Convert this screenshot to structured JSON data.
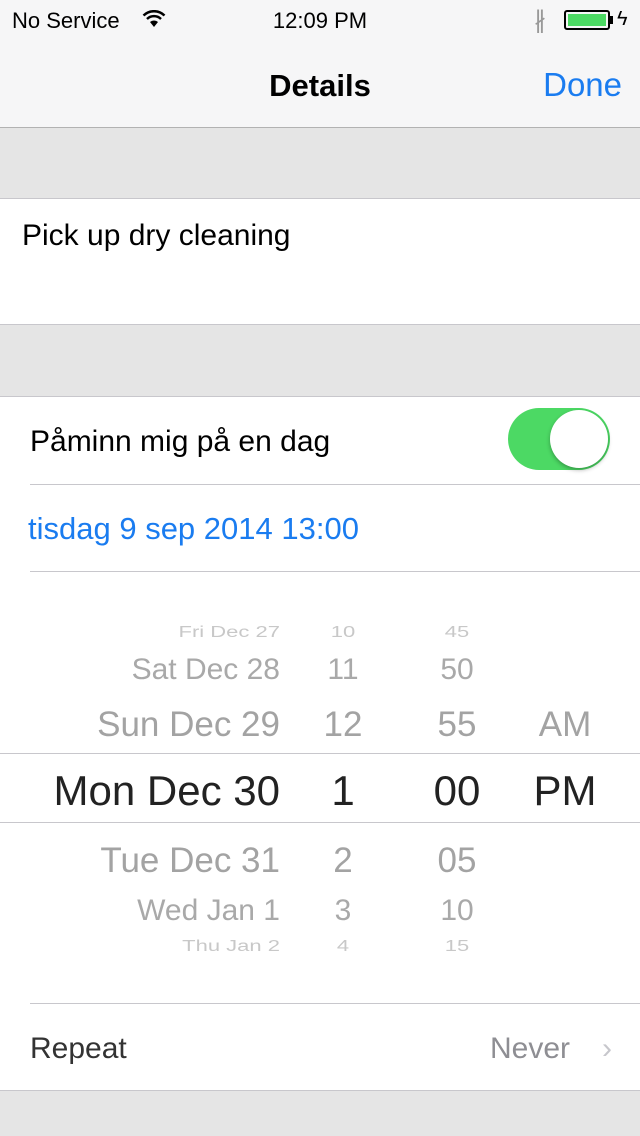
{
  "status": {
    "carrier": "No Service",
    "time": "12:09 PM",
    "battery_color": "#4cd964"
  },
  "nav": {
    "title": "Details",
    "done_label": "Done",
    "accent": "#1a7cf0"
  },
  "task": {
    "title": "Pick up dry cleaning"
  },
  "reminder": {
    "label": "Påminn mig på en dag",
    "toggle_on": true,
    "toggle_color": "#4cd964",
    "date_text": "tisdag 9 sep 2014 13:00"
  },
  "picker": {
    "rows": [
      {
        "date": "Fri Dec 27",
        "hour": "10",
        "minute": "45",
        "ampm": ""
      },
      {
        "date": "Sat Dec 28",
        "hour": "11",
        "minute": "50",
        "ampm": ""
      },
      {
        "date": "Sun Dec 29",
        "hour": "12",
        "minute": "55",
        "ampm": "AM"
      },
      {
        "date": "Mon Dec 30",
        "hour": "1",
        "minute": "00",
        "ampm": "PM"
      },
      {
        "date": "Tue Dec 31",
        "hour": "2",
        "minute": "05",
        "ampm": ""
      },
      {
        "date": "Wed Jan 1",
        "hour": "3",
        "minute": "10",
        "ampm": ""
      },
      {
        "date": "Thu Jan 2",
        "hour": "4",
        "minute": "15",
        "ampm": ""
      }
    ]
  },
  "repeat": {
    "label": "Repeat",
    "value": "Never"
  }
}
